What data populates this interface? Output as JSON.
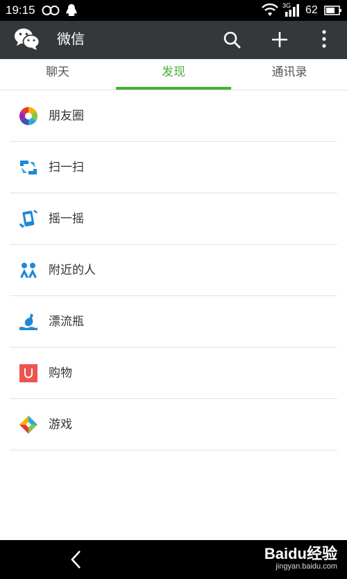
{
  "status_bar": {
    "time": "19:15",
    "network": "3G",
    "battery": "62"
  },
  "header": {
    "title": "微信"
  },
  "tabs": [
    {
      "label": "聊天",
      "active": false
    },
    {
      "label": "发现",
      "active": true
    },
    {
      "label": "通讯录",
      "active": false
    }
  ],
  "items": [
    {
      "label": "朋友圈",
      "icon": "moments-icon"
    },
    {
      "label": "扫一扫",
      "icon": "scan-icon"
    },
    {
      "label": "摇一摇",
      "icon": "shake-icon"
    },
    {
      "label": "附近的人",
      "icon": "people-nearby-icon"
    },
    {
      "label": "漂流瓶",
      "icon": "drift-bottle-icon"
    },
    {
      "label": "购物",
      "icon": "shopping-icon"
    },
    {
      "label": "游戏",
      "icon": "games-icon"
    }
  ],
  "watermark": {
    "brand": "Baidu经验",
    "url": "jingyan.baidu.com"
  },
  "colors": {
    "accent": "#45b035",
    "header_bg": "#34383b"
  }
}
